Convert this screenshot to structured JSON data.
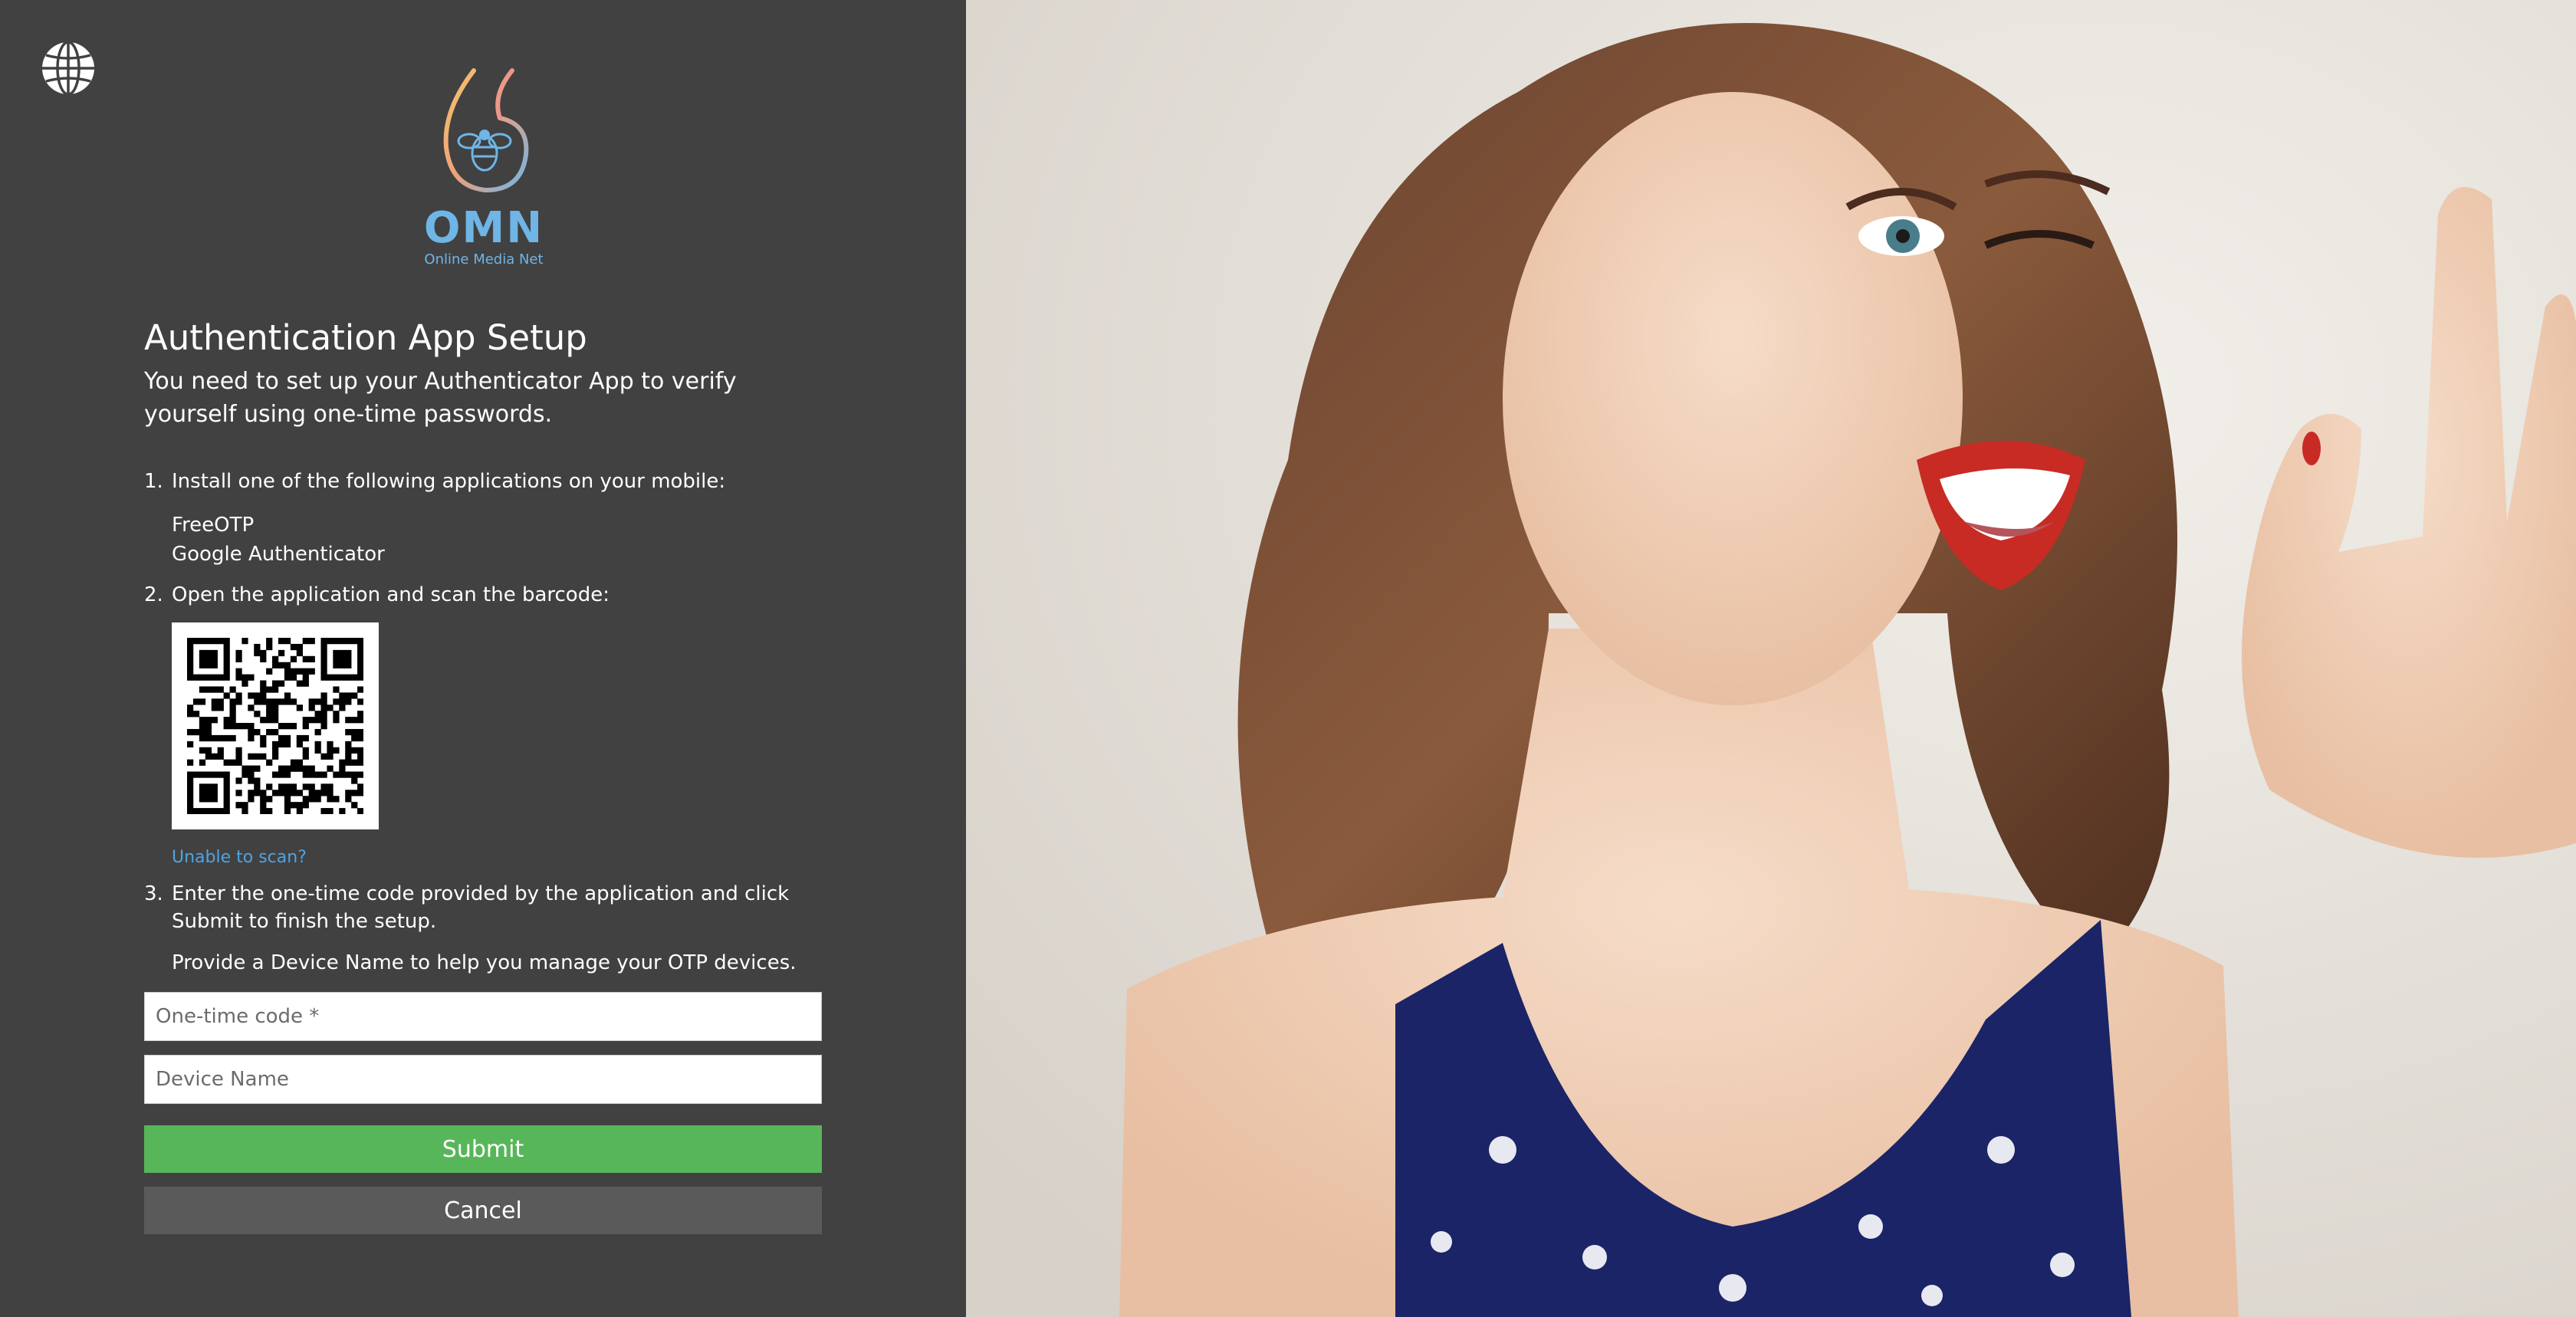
{
  "brand": {
    "logo_word": "OMN",
    "logo_tagline": "Online Media Net"
  },
  "colors": {
    "panel_bg": "#414141",
    "accent_blue": "#6fb5e6",
    "link": "#4fa3e3",
    "submit_bg": "#58b65a",
    "cancel_bg": "#5a5a5a"
  },
  "header": {
    "language_icon": "globe-icon"
  },
  "setup": {
    "title": "Authentication App Setup",
    "subtitle": "You need to set up your Authenticator App to verify yourself using one-time passwords.",
    "steps": [
      {
        "num": "1.",
        "text": "Install one of the following applications on your mobile:",
        "apps": [
          "FreeOTP",
          "Google Authenticator"
        ]
      },
      {
        "num": "2.",
        "text": "Open the application and scan the barcode:",
        "link": "Unable to scan?"
      },
      {
        "num": "3.",
        "text": "Enter the one-time code provided by the application and click Submit to finish the setup.",
        "hint": "Provide a Device Name to help you manage your OTP devices."
      }
    ]
  },
  "form": {
    "otp_placeholder": "One-time code *",
    "otp_value": "",
    "device_placeholder": "Device Name",
    "device_value": "",
    "submit_label": "Submit",
    "cancel_label": "Cancel"
  },
  "hero": {
    "icon": "hero-photo"
  }
}
